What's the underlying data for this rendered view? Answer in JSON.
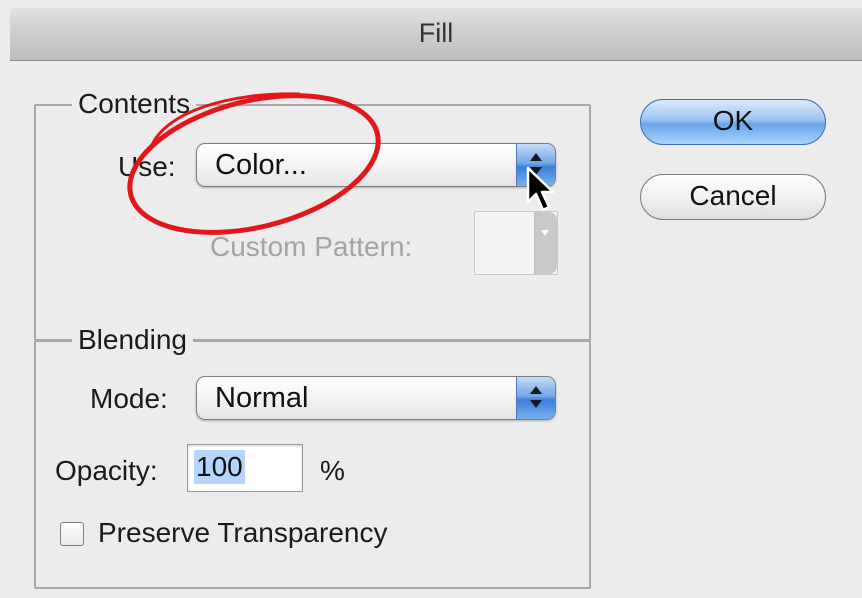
{
  "dialog": {
    "title": "Fill",
    "ok_label": "OK",
    "cancel_label": "Cancel"
  },
  "contents": {
    "group_label": "Contents",
    "use_label": "Use:",
    "use_value": "Color...",
    "custom_pattern_label": "Custom Pattern:"
  },
  "blending": {
    "group_label": "Blending",
    "mode_label": "Mode:",
    "mode_value": "Normal",
    "opacity_label": "Opacity:",
    "opacity_value": "100",
    "opacity_unit": "%",
    "preserve_label": "Preserve Transparency",
    "preserve_checked": false
  },
  "colors": {
    "annotation_circle": "#e3161c",
    "default_button": "#6aa6ec",
    "popup_arrows": "#3d80db"
  }
}
